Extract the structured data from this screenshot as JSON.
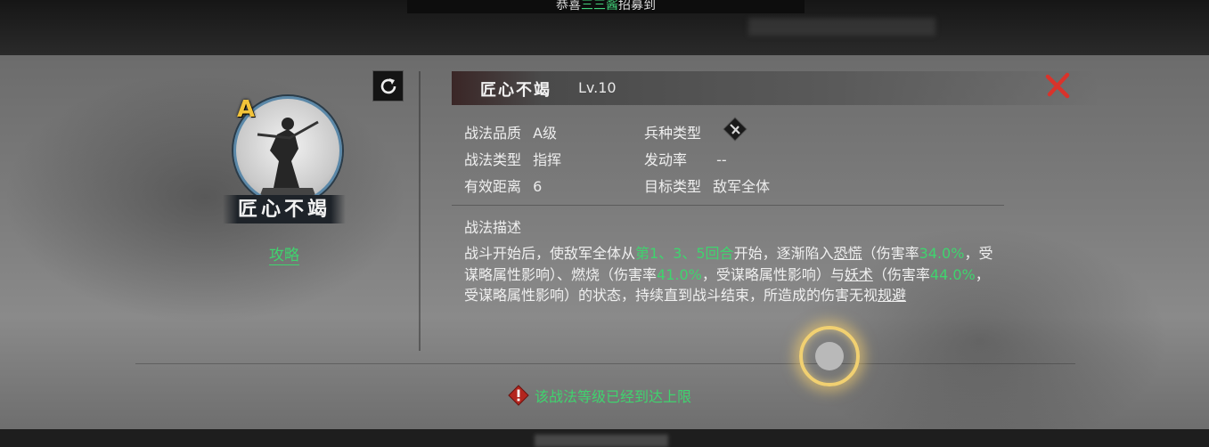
{
  "broadcast": {
    "pre": "恭喜",
    "highlight": "三三酱",
    "post": "招募到"
  },
  "skill": {
    "name": "匠心不竭",
    "level": "Lv.10",
    "grade": "A",
    "guide_label": "攻略"
  },
  "attributes": {
    "quality_label": "战法品质",
    "quality_value": "A级",
    "troop_label": "兵种类型",
    "type_label": "战法类型",
    "type_value": "指挥",
    "rate_label": "发动率",
    "rate_value": "--",
    "range_label": "有效距离",
    "range_value": "6",
    "target_label": "目标类型",
    "target_value": "敌军全体"
  },
  "description": {
    "title": "战法描述",
    "p1": "战斗开始后，使敌军全体从",
    "rounds": "第1、3、5回合",
    "p2": "开始，逐渐陷入",
    "panic": "恐慌",
    "p3": "（伤害率",
    "v1": "34.0%",
    "p4": "，受谋略属性影响）、燃烧（伤害率",
    "v2": "41.0%",
    "p5": "，受谋略属性影响）与",
    "sorcery": "妖术",
    "p6": "（伤害率",
    "v3": "44.0%",
    "p7": "，受谋略属性影响）的状态，持续直到战斗结束，所造成的伤害无视",
    "evade": "规避"
  },
  "warning": "该战法等级已经到达上限",
  "icons": [
    "refresh-icon",
    "close-icon",
    "troop-type-icon",
    "warning-icon",
    "portrait-image"
  ],
  "colors": {
    "accent_green": "#3fd46e",
    "grade_gold": "#f2c33a",
    "close_red": "#d9332b"
  }
}
